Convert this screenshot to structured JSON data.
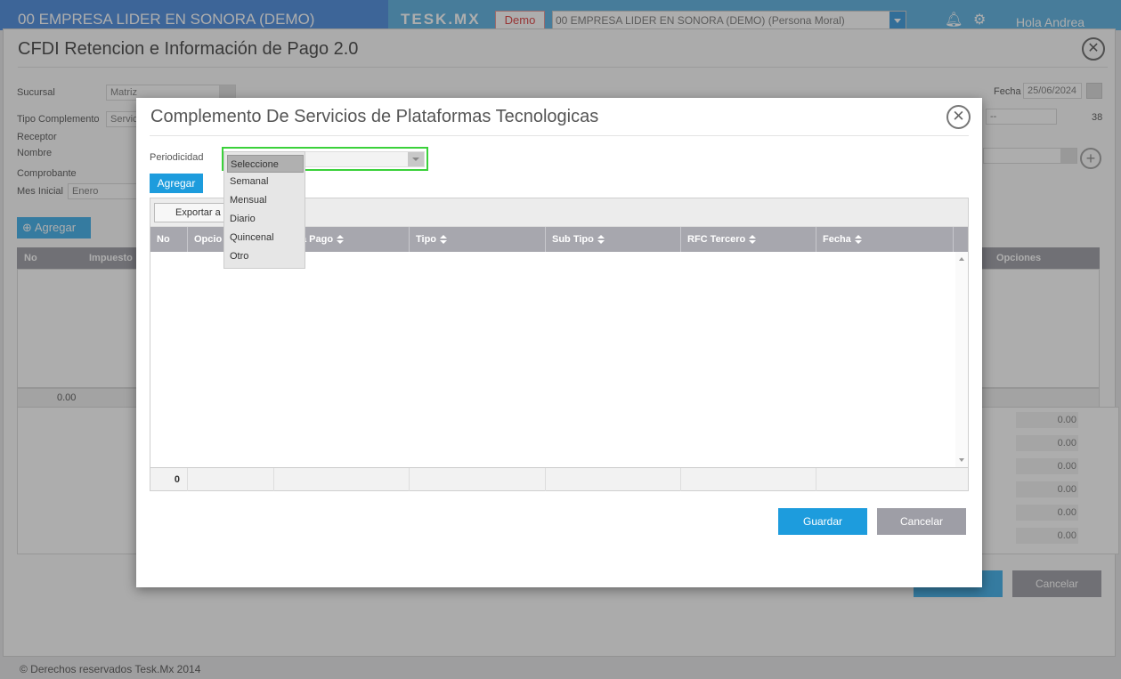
{
  "topbar": {
    "company_title": "00 EMPRESA LIDER EN SONORA (DEMO)",
    "brand": "TESK.MX",
    "demo_badge": "Demo",
    "company_select_value": "00 EMPRESA LIDER EN SONORA (DEMO) (Persona Moral)",
    "greeting": "Hola Andrea",
    "icons": [
      "bell-icon",
      "gear-icon"
    ]
  },
  "page": {
    "title": "CFDI Retencion e Información de Pago 2.0",
    "fields": {
      "sucursal_label": "Sucursal",
      "sucursal_value": "Matriz",
      "tipo_complemento_label": "Tipo Complemento",
      "tipo_complemento_value": "Servic",
      "receptor_label": "Receptor",
      "nombre_label": "Nombre",
      "comprobante_label": "Comprobante",
      "mes_inicial_label": "Mes Inicial",
      "mes_inicial_value": "Enero",
      "fecha_label": "Fecha",
      "fecha_value": "25/06/2024",
      "right_select_value": "--",
      "right_number": "38"
    },
    "add_button": "Agregar",
    "table_columns": [
      "No",
      "Impuesto",
      "Opciones"
    ],
    "table_footer_total": "0.00",
    "totals": [
      "0.00",
      "0.00",
      "0.00",
      "0.00",
      "0.00",
      "0.00"
    ],
    "cancel_button": "Cancelar",
    "footer": "© Derechos reservados Tesk.Mx 2014"
  },
  "modal": {
    "title": "Complemento De Servicios de Plataformas Tecnologicas",
    "periodicidad_label": "Periodicidad",
    "periodicidad_selected": "Seleccione",
    "periodicidad_options": [
      "Seleccione",
      "Semanal",
      "Mensual",
      "Diario",
      "Quincenal",
      "Otro"
    ],
    "agregar_button": "Agregar",
    "export_button": "Exportar a",
    "grid_columns": [
      "No",
      "Opciones",
      "Forma Pago",
      "Tipo",
      "Sub Tipo",
      "RFC Tercero",
      "Fecha"
    ],
    "grid_column_headers_visible": [
      "No",
      "Opcio",
      "a Pago",
      "Tipo",
      "Sub Tipo",
      "RFC Tercero",
      "Fecha"
    ],
    "grid_footer_count": "0",
    "guardar_button": "Guardar",
    "cancelar_button": "Cancelar"
  },
  "colors": {
    "primary": "#1d9cdd",
    "topbar_left": "#5b95e0",
    "topbar": "#69b7e3",
    "header_gray": "#a7a7ae",
    "focus_outline": "#3ad13a"
  }
}
